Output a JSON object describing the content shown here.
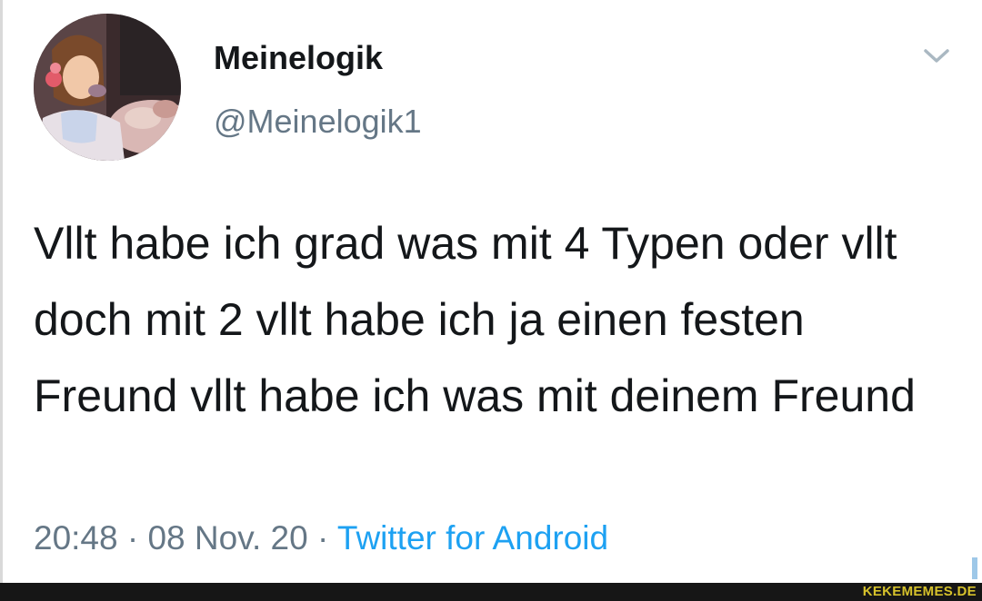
{
  "author": {
    "display_name": "Meinelogik",
    "handle": "@Meinelogik1",
    "avatar": "cartoon-princess-avatar"
  },
  "tweet": {
    "text": "Vllt habe ich grad was mit 4 Typen oder vllt doch mit 2 vllt habe ich ja einen festen Freund vllt habe ich was mit deinem Freund",
    "time": "20:48",
    "date": "08 Nov. 20",
    "separator": " · ",
    "source": "Twitter for Android"
  },
  "menu_icon": "chevron-down-icon",
  "watermark": "KEKEMEMES.DE",
  "colors": {
    "text": "#14171a",
    "secondary": "#657786",
    "link": "#1da1f2",
    "footer": "#161616",
    "watermark": "#d6c22b"
  }
}
